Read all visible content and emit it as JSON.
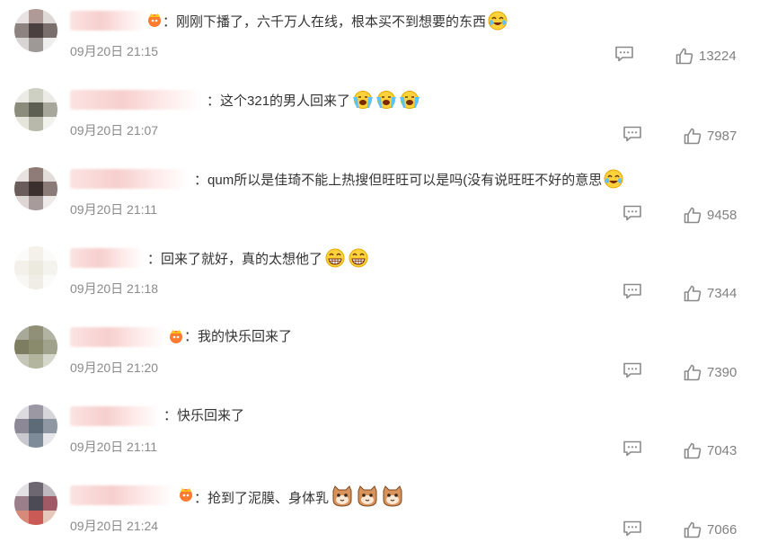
{
  "comments": [
    {
      "sep": "：",
      "text": "刚刚下播了，六千万人在线，根本买不到想要的东西",
      "time": "09月20日 21:15",
      "likes": "13224",
      "emoji": [
        "laugh-cry-emoji"
      ],
      "vip": true
    },
    {
      "sep": "：",
      "text": "这个321的男人回来了",
      "time": "09月20日 21:07",
      "likes": "7987",
      "emoji": [
        "crying-emoji",
        "crying-emoji",
        "crying-emoji"
      ],
      "vip": false
    },
    {
      "sep": "：",
      "text": "qum所以是佳琦不能上热搜但旺旺可以是吗(没有说旺旺不好的意思",
      "time": "09月20日 21:11",
      "likes": "9458",
      "emoji": [
        "laugh-cry-emoji"
      ],
      "vip": false
    },
    {
      "sep": "：",
      "text": "回来了就好，真的太想他了",
      "time": "09月20日 21:18",
      "likes": "7344",
      "emoji": [
        "grin-emoji",
        "grin-emoji"
      ],
      "vip": false
    },
    {
      "sep": "：",
      "text": "我的快乐回来了",
      "time": "09月20日 21:20",
      "likes": "7390",
      "emoji": [],
      "vip": true
    },
    {
      "sep": "：",
      "text": "快乐回来了",
      "time": "09月20日 21:11",
      "likes": "7043",
      "emoji": [],
      "vip": false
    },
    {
      "sep": "：",
      "text": "抢到了泥膜、身体乳",
      "time": "09月20日 21:24",
      "likes": "7066",
      "emoji": [
        "cat-emoji",
        "cat-emoji",
        "cat-emoji"
      ],
      "vip": true
    }
  ],
  "colors": {
    "text": "#333333",
    "meta": "#8a8a8a",
    "icon": "#8a8a8a"
  },
  "icons": {
    "reply": "comment-icon",
    "like": "thumbs-up-icon",
    "vip": "vip-crown-badge"
  }
}
